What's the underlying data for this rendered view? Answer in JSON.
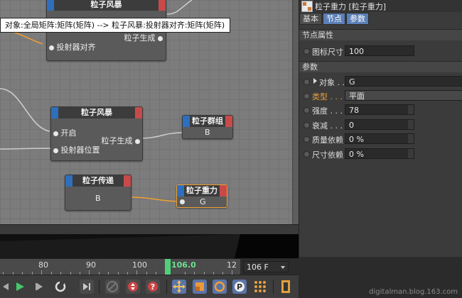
{
  "tooltip": "对象:全局矩阵:矩阵(矩阵) --> 粒子风暴:投射器对齐:矩阵(矩阵)",
  "nodes": {
    "storm_top": {
      "title": "粒子风暴",
      "port_out": "粒子生成",
      "port_in": "投射器对齐"
    },
    "storm": {
      "title": "粒子风暴",
      "port_in_1": "开启",
      "port_in_2": "投射器位置",
      "port_out": "粒子生成"
    },
    "group": {
      "title": "粒子群组",
      "value": "B"
    },
    "pass": {
      "title": "粒子传递",
      "value": "B"
    },
    "gravity": {
      "title": "粒子重力",
      "value": "G"
    }
  },
  "attributes": {
    "title": "粒子重力 [粒子重力]",
    "tabs": [
      "基本",
      "节点",
      "参数"
    ],
    "node_section": "节点属性",
    "icon_size_label": "图标尺寸",
    "icon_size_value": "100",
    "param_section": "参数",
    "rows": [
      {
        "label": "对象 . .",
        "value": "G"
      },
      {
        "label": "类型 . . .",
        "value": "平面"
      },
      {
        "label": "强度 . . .",
        "value": "78"
      },
      {
        "label": "衰减 . . .",
        "value": "0"
      },
      {
        "label": "质量依赖",
        "value": "0 %"
      },
      {
        "label": "尺寸依赖",
        "value": "0 %"
      }
    ]
  },
  "timeline": {
    "ticks": [
      "80",
      "90",
      "100",
      "12"
    ],
    "current_frame": "106.0",
    "frame_field": "106 F"
  },
  "watermark": "digitalman.blog.163.com",
  "colors": {
    "accent_blue": "#5b7fb6",
    "playhead": "#4fd07a",
    "selected_node": "#f0a030",
    "wire": "#f0a030"
  }
}
